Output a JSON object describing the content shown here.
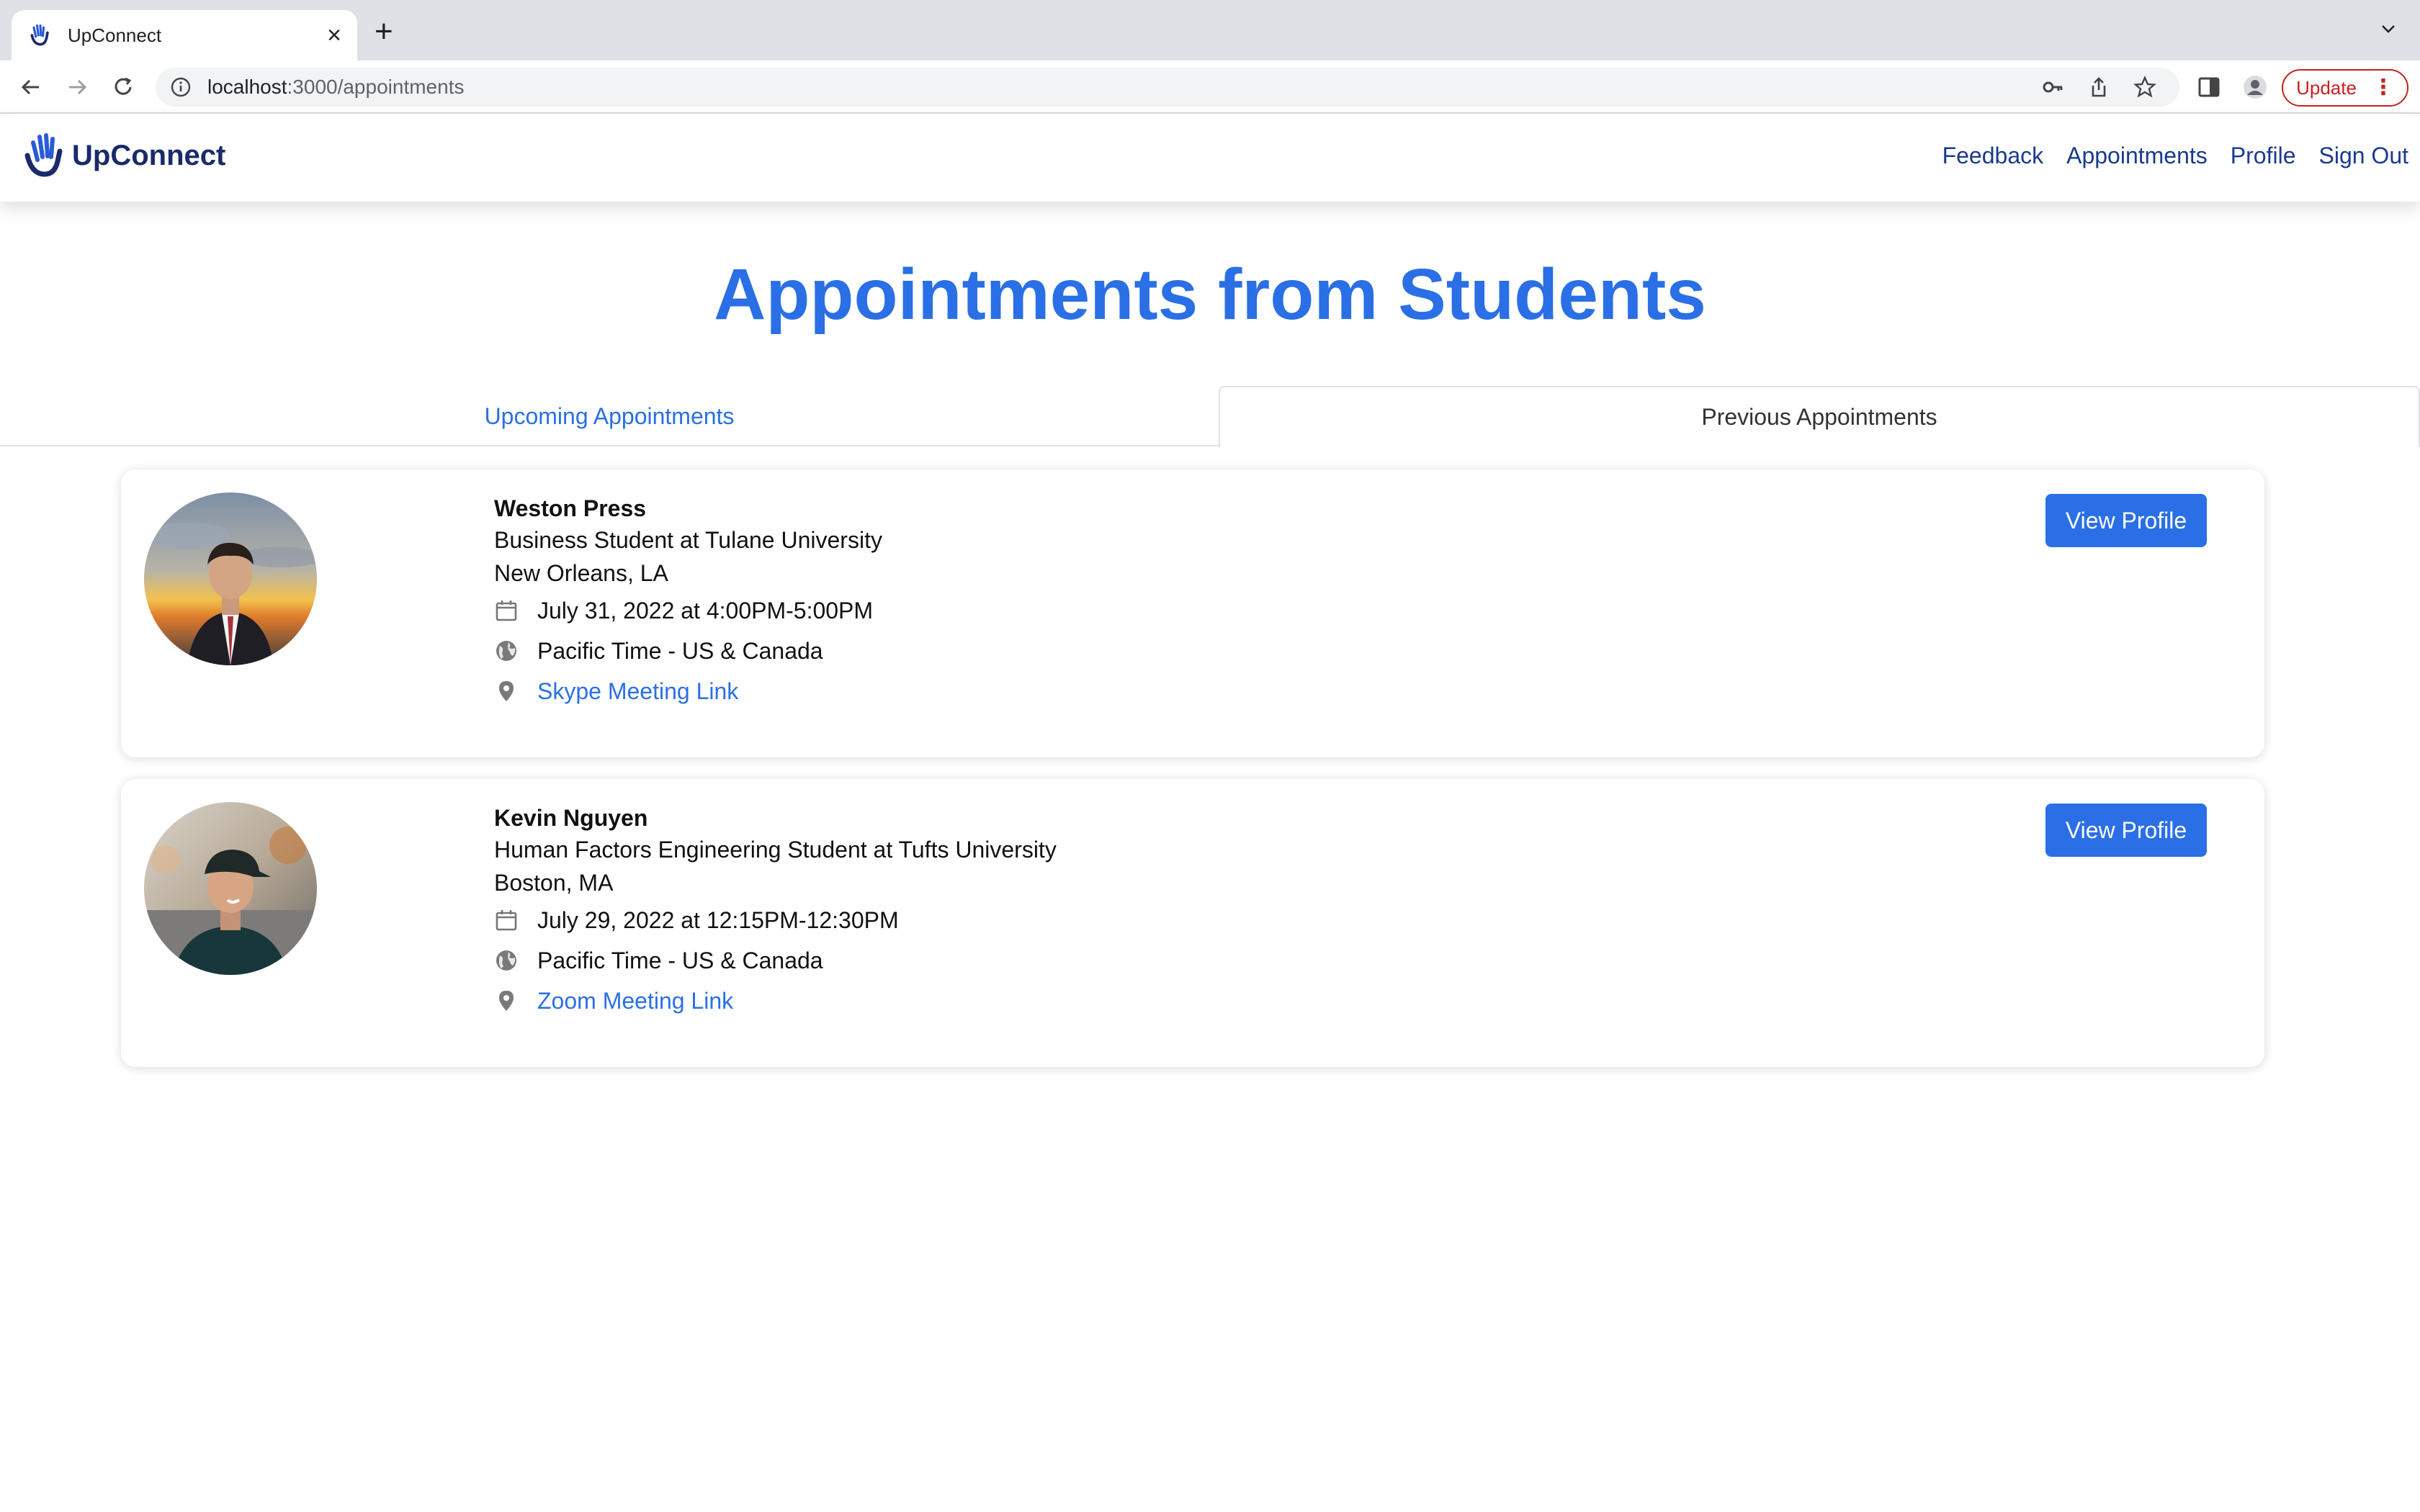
{
  "browser": {
    "tab_title": "UpConnect",
    "url_host": "localhost",
    "url_path": ":3000/appointments",
    "update_label": "Update"
  },
  "app": {
    "brand": "UpConnect",
    "nav": [
      "Feedback",
      "Appointments",
      "Profile",
      "Sign Out"
    ]
  },
  "page": {
    "title": "Appointments from Students",
    "tabs": [
      "Upcoming Appointments",
      "Previous Appointments"
    ],
    "view_profile_label": "View Profile"
  },
  "appointments": [
    {
      "name": "Weston Press",
      "headline": "Business Student at Tulane University",
      "location": "New Orleans, LA",
      "datetime": "July 31, 2022 at 4:00PM-5:00PM",
      "timezone": "Pacific Time - US & Canada",
      "link_label": "Skype Meeting Link"
    },
    {
      "name": "Kevin Nguyen",
      "headline": "Human Factors Engineering Student at Tufts University",
      "location": "Boston, MA",
      "datetime": "July 29, 2022 at 12:15PM-12:30PM",
      "timezone": "Pacific Time - US & Canada",
      "link_label": "Zoom Meeting Link"
    }
  ],
  "colors": {
    "primary": "#2a6fe6",
    "brand_dark": "#1b2a6b",
    "update_red": "#c5221f"
  }
}
